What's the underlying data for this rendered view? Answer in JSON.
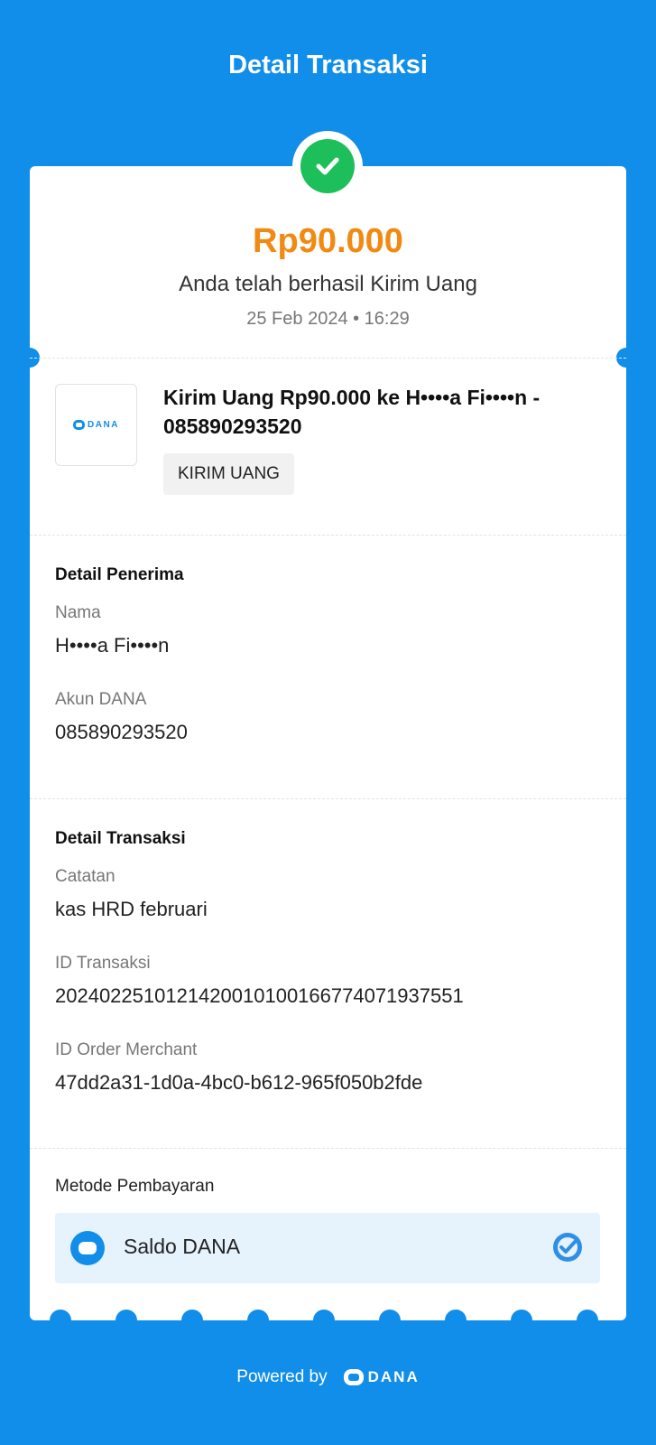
{
  "header": {
    "title": "Detail Transaksi"
  },
  "summary": {
    "amount": "Rp90.000",
    "status": "Anda telah berhasil Kirim Uang",
    "datetime": "25 Feb 2024 • 16:29"
  },
  "transaction": {
    "logo_text": "DANA",
    "title": "Kirim Uang Rp90.000 ke H••••a Fi••••n - 085890293520",
    "tag": "KIRIM UANG"
  },
  "recipient": {
    "section_title": "Detail Penerima",
    "name_label": "Nama",
    "name_value": "H••••a Fi••••n",
    "account_label": "Akun DANA",
    "account_value": "085890293520"
  },
  "details": {
    "section_title": "Detail Transaksi",
    "note_label": "Catatan",
    "note_value": "kas HRD februari",
    "txid_label": "ID Transaksi",
    "txid_value": "2024022510121420010100166774071937551",
    "order_label": "ID Order Merchant",
    "order_value": "47dd2a31-1d0a-4bc0-b612-965f050b2fde"
  },
  "payment": {
    "section_title": "Metode Pembayaran",
    "method": "Saldo DANA"
  },
  "footer": {
    "powered_by": "Powered by",
    "logo_text": "DANA"
  },
  "colors": {
    "brand_blue": "#118EEA",
    "amount_orange": "#F18A12",
    "success_green": "#1DBF5B"
  },
  "icons": {
    "status": "check-circle-icon",
    "payment": "dana-wallet-icon",
    "selected": "selected-check-icon"
  }
}
